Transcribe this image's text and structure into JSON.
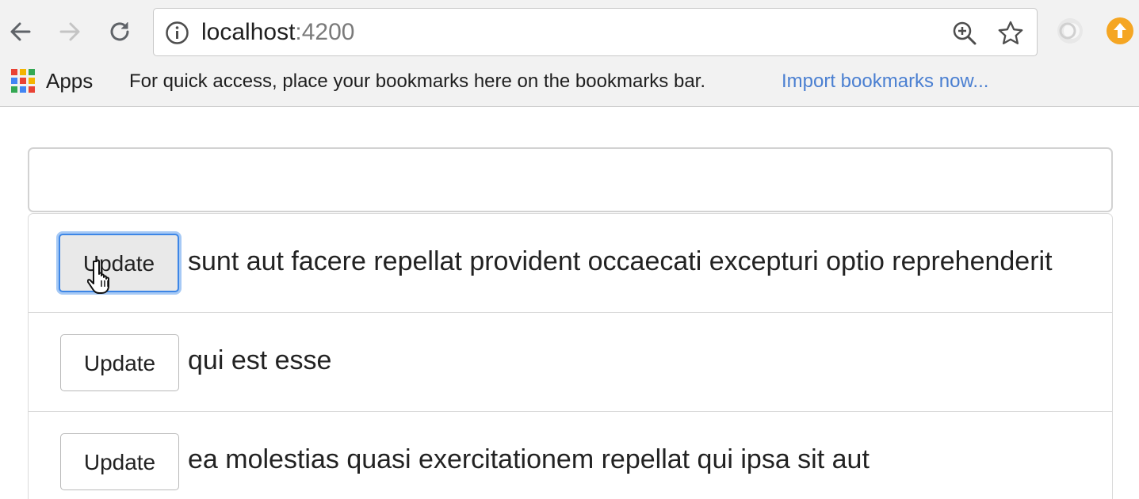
{
  "browser": {
    "url_host": "localhost",
    "url_port": ":4200",
    "icons": {
      "back": "back-arrow-icon",
      "forward": "forward-arrow-icon",
      "reload": "reload-icon",
      "info": "info-icon",
      "zoom": "zoom-icon",
      "star": "bookmark-star-icon",
      "extension_1": "extension-icon",
      "extension_2": "update-extension-icon"
    }
  },
  "bookmarks_bar": {
    "apps_label": "Apps",
    "hint": "For quick access, place your bookmarks here on the bookmarks bar.",
    "import_link": "Import bookmarks now..."
  },
  "page": {
    "input_value": "",
    "items": [
      {
        "button_label": "Update",
        "title": "sunt aut facere repellat provident occaecati excepturi optio reprehenderit"
      },
      {
        "button_label": "Update",
        "title": "qui est esse"
      },
      {
        "button_label": "Update",
        "title": "ea molestias quasi exercitationem repellat qui ipsa sit aut"
      }
    ]
  },
  "colors": {
    "link": "#4a7fd1",
    "focus_ring": "#3d86e6",
    "extension_orange": "#f5a623"
  }
}
